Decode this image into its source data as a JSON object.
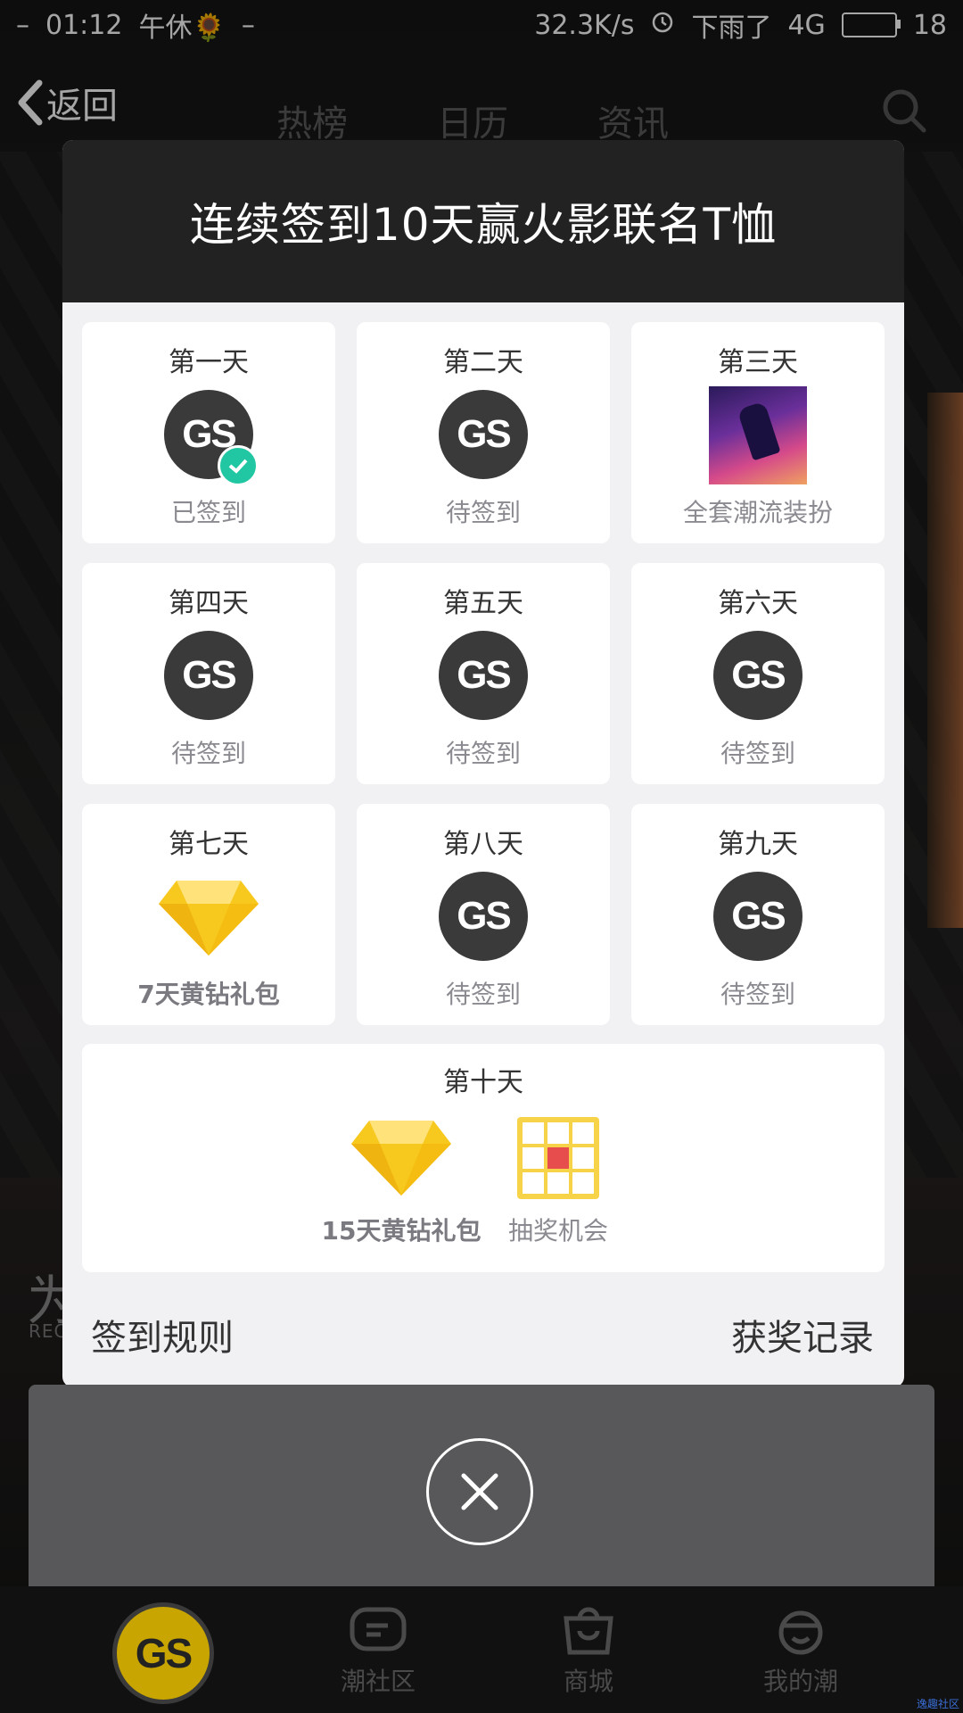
{
  "status_bar": {
    "time": "01:12",
    "left_dash": "–",
    "note": "午休🌻",
    "dash2": "–",
    "net_speed": "32.3K/s",
    "weather": "下雨了",
    "network": "4G",
    "battery": "18"
  },
  "nav": {
    "back_label": "返回",
    "tabs": [
      "热榜",
      "日历",
      "资讯"
    ]
  },
  "modal": {
    "title": "连续签到10天赢火影联名T恤",
    "days": [
      {
        "day": "第一天",
        "status": "已签到",
        "icon": "gs-logo-checked"
      },
      {
        "day": "第二天",
        "status": "待签到",
        "icon": "gs-logo"
      },
      {
        "day": "第三天",
        "status": "全套潮流装扮",
        "icon": "outfit-image"
      },
      {
        "day": "第四天",
        "status": "待签到",
        "icon": "gs-logo"
      },
      {
        "day": "第五天",
        "status": "待签到",
        "icon": "gs-logo"
      },
      {
        "day": "第六天",
        "status": "待签到",
        "icon": "gs-logo"
      },
      {
        "day": "第七天",
        "status": "7天黄钻礼包",
        "icon": "diamond-icon"
      },
      {
        "day": "第八天",
        "status": "待签到",
        "icon": "gs-logo"
      },
      {
        "day": "第九天",
        "status": "待签到",
        "icon": "gs-logo"
      }
    ],
    "day10": {
      "day": "第十天",
      "reward1": "15天黄钻礼包",
      "reward2": "抽奖机会"
    },
    "rules_link": "签到规则",
    "records_link": "获奖记录"
  },
  "background": {
    "section_char": "为",
    "section_sub": "RECO"
  },
  "bottom_nav": {
    "logo": "GS",
    "items": [
      "潮社区",
      "商城",
      "我的潮"
    ]
  },
  "watermark": "逸趣社区",
  "colors": {
    "check_green": "#21c7a2",
    "diamond_yellow": "#f7c81e",
    "header_dark": "#222222"
  }
}
